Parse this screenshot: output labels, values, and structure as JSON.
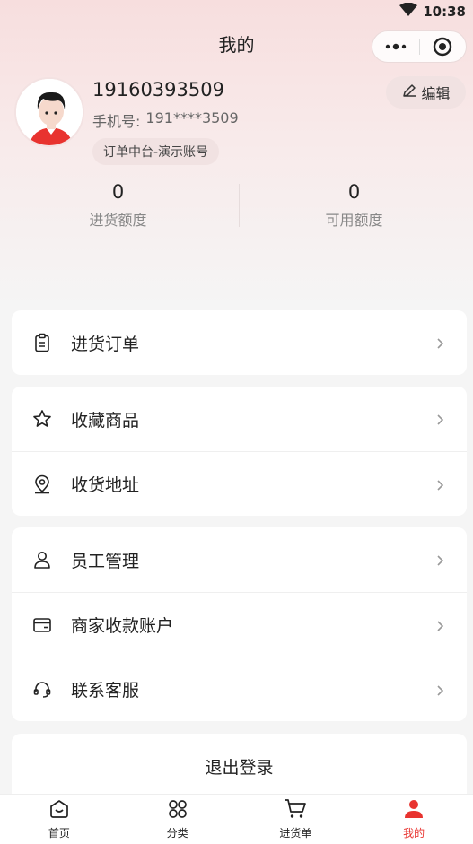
{
  "status_bar": {
    "time": "10:38",
    "wifi_icon": "wifi-icon"
  },
  "nav": {
    "title": "我的",
    "more_icon": "more-dots-icon",
    "close_icon": "target-close-icon"
  },
  "profile": {
    "name": "19160393509",
    "phone_label": "手机号:",
    "phone_masked": "191****3509",
    "tag": "订单中台-演示账号",
    "edit_label": "编辑",
    "edit_icon": "pencil-icon"
  },
  "stats": [
    {
      "value": "0",
      "label": "进货额度"
    },
    {
      "value": "0",
      "label": "可用额度"
    }
  ],
  "menu": {
    "group1": [
      {
        "label": "进货订单",
        "icon": "clipboard-icon"
      }
    ],
    "group2": [
      {
        "label": "收藏商品",
        "icon": "star-icon"
      },
      {
        "label": "收货地址",
        "icon": "location-pin-icon"
      }
    ],
    "group3": [
      {
        "label": "员工管理",
        "icon": "user-icon"
      },
      {
        "label": "商家收款账户",
        "icon": "wallet-icon"
      },
      {
        "label": "联系客服",
        "icon": "headset-icon"
      }
    ]
  },
  "logout_label": "退出登录",
  "tabbar": [
    {
      "label": "首页",
      "icon": "home-smile-icon",
      "active": false
    },
    {
      "label": "分类",
      "icon": "category-grid-icon",
      "active": false
    },
    {
      "label": "进货单",
      "icon": "cart-icon",
      "active": false
    },
    {
      "label": "我的",
      "icon": "person-icon",
      "active": true
    }
  ],
  "colors": {
    "accent": "#e8332f",
    "header_bg": "#f7dede"
  }
}
